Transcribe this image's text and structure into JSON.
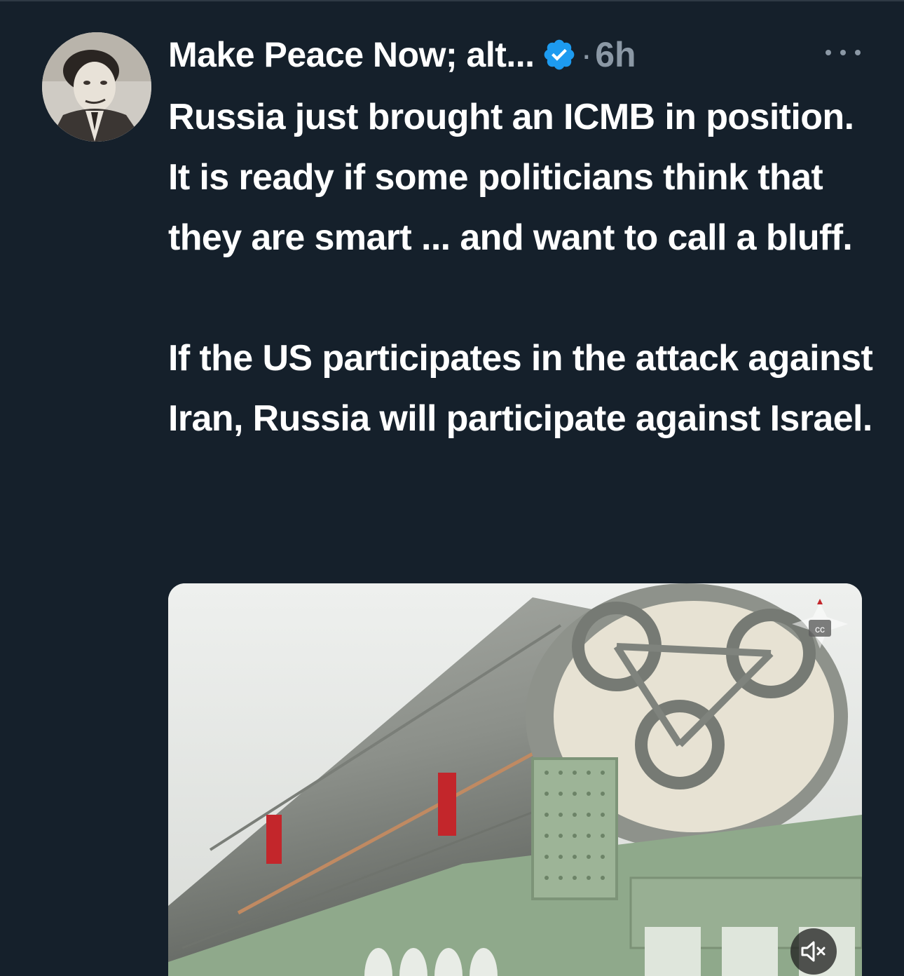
{
  "tweet": {
    "display_name": "Make Peace Now; alt...",
    "dot": "·",
    "time": "6h",
    "verified": true,
    "text_paragraphs": [
      "Russia just brought an ICMB in position. It is ready if some politicians think that they are smart ... and want to call a bluff.",
      "If the US participates in the attack against Iran, Russia will participate against Israel."
    ]
  },
  "icons": {
    "verified": "verified-badge-icon",
    "more": "more-options-icon",
    "mute": "muted-speaker-icon",
    "watermark": "emblem-watermark-icon"
  },
  "colors": {
    "background": "#15202b",
    "text": "#ffffff",
    "secondary": "#8b98a5",
    "verified": "#1d9bf0"
  }
}
